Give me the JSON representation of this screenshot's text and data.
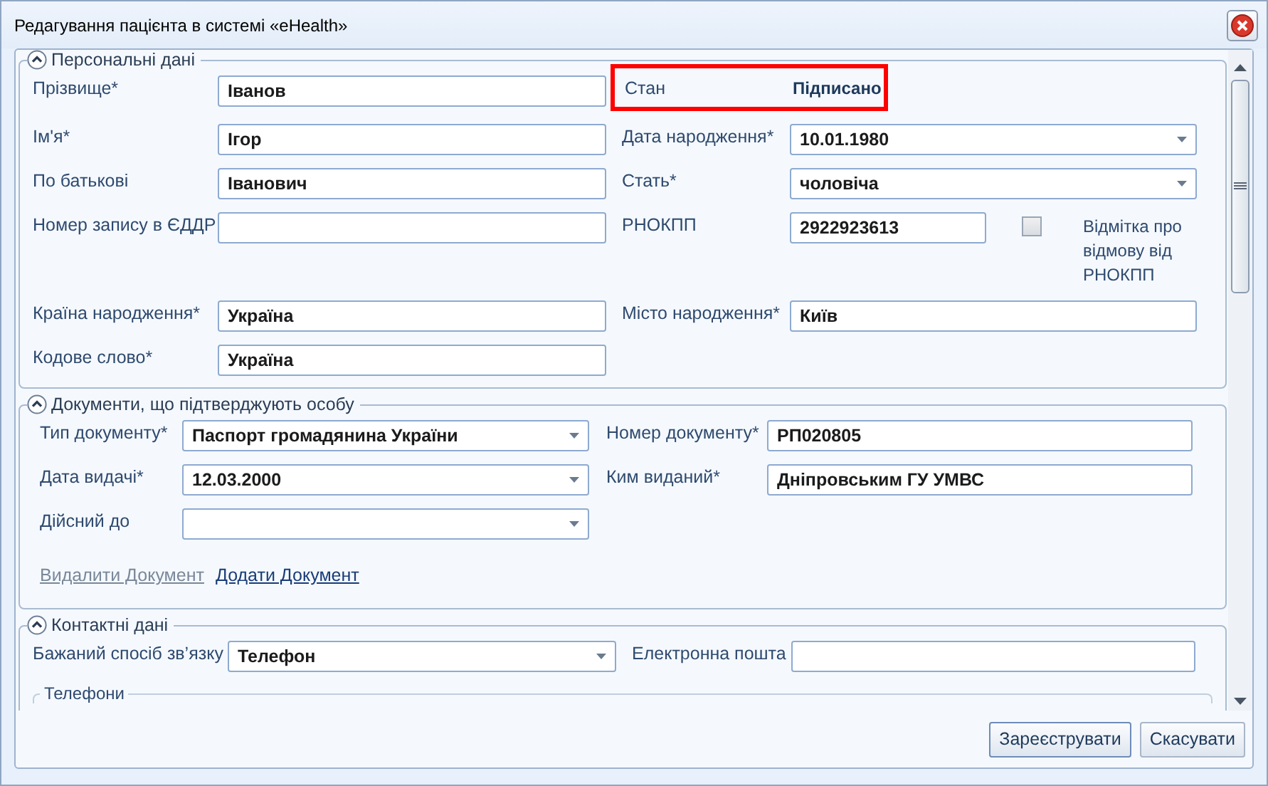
{
  "window": {
    "title": "Редагування пацієнта в системі «eHealth»"
  },
  "personal_data": {
    "title": "Персональні дані",
    "expanded": true,
    "rows": [
      {
        "left": {
          "kind": "text",
          "label": "Прізвище*",
          "value": "Іванов"
        },
        "right": {
          "kind": "status",
          "label": "Стан",
          "value": "Підписано",
          "highlighted": true
        }
      },
      {
        "left": {
          "kind": "text",
          "label": "Ім'я*",
          "value": "Ігор"
        },
        "right": {
          "kind": "dropdown",
          "label": "Дата народження*",
          "value": "10.01.1980"
        }
      },
      {
        "left": {
          "kind": "text",
          "label": "По батькові",
          "value": "Іванович"
        },
        "right": {
          "kind": "dropdown",
          "label": "Стать*",
          "value": "чоловіча"
        }
      },
      {
        "left": {
          "kind": "text",
          "label": "Номер запису в ЄДДР"
        },
        "right": {
          "kind": "text_checkbox",
          "label": "РНОКПП",
          "value": "2922923613",
          "checkbox": {
            "label": "Відмітка про відмову від РНОКПП",
            "checked": false
          }
        }
      },
      {
        "left": {
          "kind": "text",
          "label": "Країна народження*",
          "value": "Україна"
        },
        "right": {
          "kind": "text",
          "label": "Місто народження*",
          "value": "Київ"
        }
      },
      {
        "left": {
          "kind": "text",
          "label": "Кодове слово*",
          "value": "Україна"
        }
      }
    ]
  },
  "documents": {
    "title": "Документи, що підтверджують особу",
    "expanded": true,
    "rows": [
      {
        "left": {
          "kind": "dropdown",
          "label": "Тип документу*",
          "value": "Паспорт громадянина України"
        },
        "right": {
          "kind": "text",
          "label": "Номер документу*",
          "value": "РП020805"
        }
      },
      {
        "left": {
          "kind": "dropdown",
          "label": "Дата видачі*",
          "value": "12.03.2000"
        },
        "right": {
          "kind": "text",
          "label": "Ким виданий*",
          "value": "Дніпровським ГУ УМВС"
        }
      },
      {
        "left": {
          "kind": "dropdown",
          "label": "Дійсний до"
        }
      }
    ],
    "links": [
      {
        "label": "Видалити Документ",
        "disabled": true
      },
      {
        "label": "Додати Документ",
        "disabled": false
      }
    ]
  },
  "contacts": {
    "title": "Контактні дані",
    "expanded": true,
    "rows": [
      {
        "left": {
          "kind": "dropdown",
          "label": "Бажаний спосіб зв’язку",
          "value": "Телефон"
        },
        "right": {
          "kind": "text",
          "label": "Електронна пошта"
        }
      }
    ],
    "subsection": "Телефони"
  },
  "buttons": [
    {
      "label": "Зареєструвати",
      "default": true
    },
    {
      "label": "Скасувати",
      "default": false
    }
  ]
}
